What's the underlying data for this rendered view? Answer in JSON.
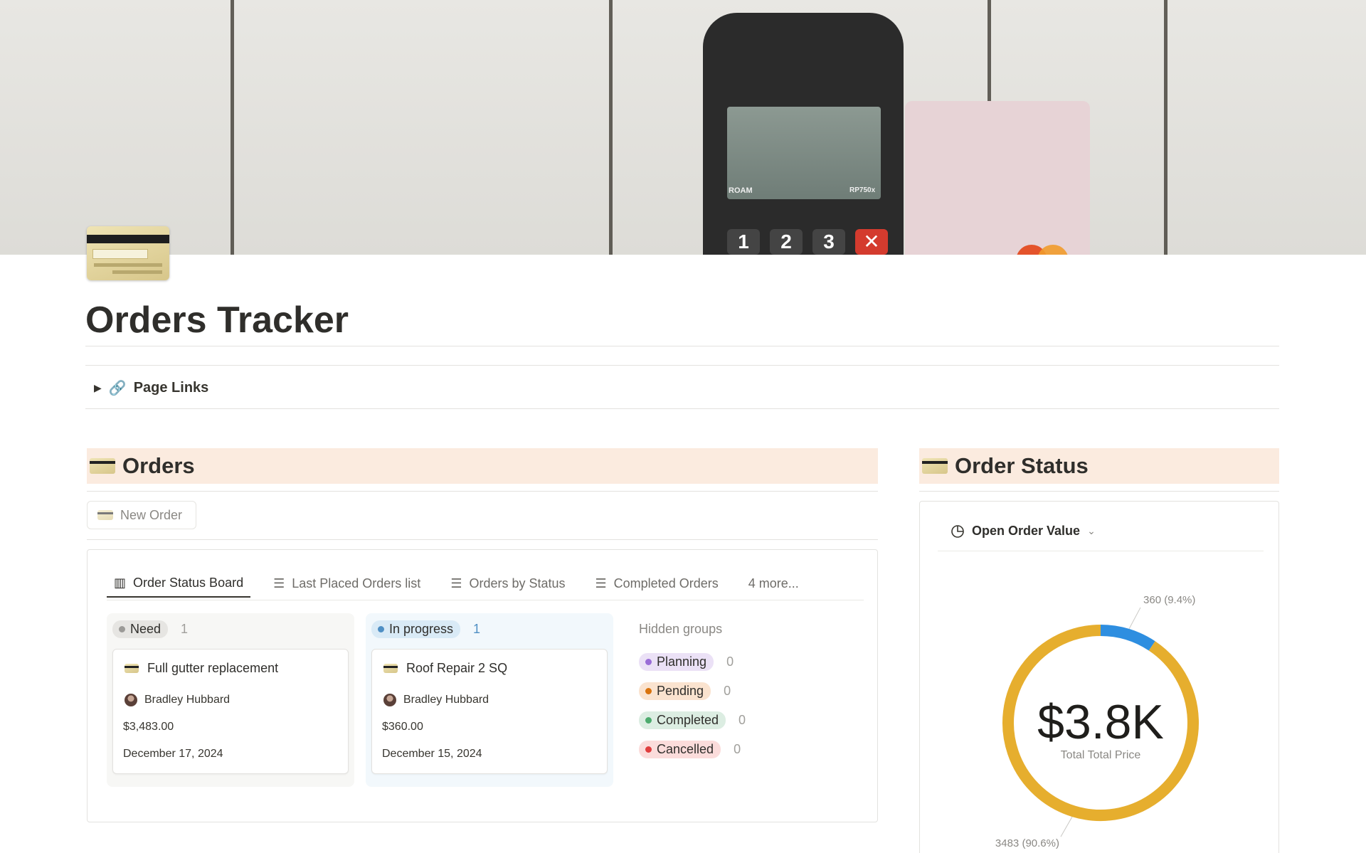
{
  "page": {
    "title": "Orders Tracker"
  },
  "cover": {
    "terminal_brand": "ROAM",
    "terminal_model": "RP750x",
    "keys": [
      "1",
      "2",
      "3"
    ]
  },
  "page_links": {
    "label": "Page Links"
  },
  "orders_section": {
    "heading": "Orders",
    "new_button": "New Order",
    "tabs": [
      {
        "label": "Order Status Board",
        "icon": "board-icon",
        "active": true
      },
      {
        "label": "Last Placed Orders list",
        "icon": "list-icon"
      },
      {
        "label": "Orders by Status",
        "icon": "list-icon"
      },
      {
        "label": "Completed Orders",
        "icon": "list-icon"
      },
      {
        "label": "4 more...",
        "icon": ""
      }
    ],
    "columns": [
      {
        "status": "Need",
        "count": "1",
        "color": "#9b9a97",
        "pill_bg": "#e6e5e2",
        "col_bg": "#f7f7f5",
        "cards": [
          {
            "title": "Full gutter replacement",
            "person": "Bradley Hubbard",
            "price": "$3,483.00",
            "date": "December 17, 2024"
          }
        ]
      },
      {
        "status": "In progress",
        "count": "1",
        "color": "#4f8fc4",
        "pill_bg": "#d9eaf6",
        "col_bg": "#f2f8fc",
        "cards": [
          {
            "title": "Roof Repair 2 SQ",
            "person": "Bradley Hubbard",
            "price": "$360.00",
            "date": "December 15, 2024"
          }
        ]
      }
    ],
    "hidden_groups": {
      "label": "Hidden groups",
      "items": [
        {
          "status": "Planning",
          "count": "0",
          "color": "#9a6dd7",
          "bg": "#ebe1f6"
        },
        {
          "status": "Pending",
          "count": "0",
          "color": "#d9730d",
          "bg": "#fae3cf"
        },
        {
          "status": "Completed",
          "count": "0",
          "color": "#4dab6e",
          "bg": "#dcede2"
        },
        {
          "status": "Cancelled",
          "count": "0",
          "color": "#e03e3e",
          "bg": "#fbdcdb"
        }
      ]
    }
  },
  "status_section": {
    "heading": "Order Status",
    "chart_selector": "Open Order Value",
    "center_value": "$3.8K",
    "center_caption": "Total Total Price",
    "slice_labels": [
      "360 (9.4%)",
      "3483 (90.6%)"
    ]
  },
  "chart_data": {
    "type": "pie",
    "title": "",
    "categories": [
      "In progress",
      "Need"
    ],
    "values": [
      360,
      3483
    ],
    "colors": [
      "#2e8ee0",
      "#e6ae2e"
    ],
    "total_label": "$3.8K",
    "caption": "Total Total Price"
  }
}
